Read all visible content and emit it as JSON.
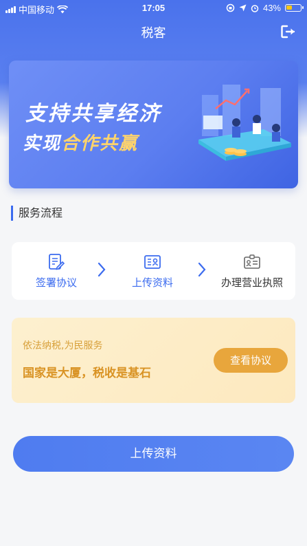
{
  "status_bar": {
    "carrier": "中国移动",
    "time": "17:05",
    "battery": "43%",
    "icons": [
      "signal-icon",
      "wifi-icon",
      "orientation-lock-icon",
      "location-icon",
      "alarm-icon",
      "battery-icon"
    ]
  },
  "nav": {
    "title": "税客",
    "logout_icon": "logout-icon"
  },
  "banner": {
    "line1": "支持共享经济",
    "line2_white": "实现",
    "line2_highlight": "合作共赢",
    "highlight_color": "#ffd46b"
  },
  "section": {
    "title": "服务流程"
  },
  "process": {
    "steps": [
      {
        "label": "签署协议",
        "icon": "sign-document-icon"
      },
      {
        "label": "上传资料",
        "icon": "id-card-icon"
      },
      {
        "label": "办理营业执照",
        "icon": "business-license-icon"
      }
    ]
  },
  "notice": {
    "subtitle": "依法纳税,为民服务",
    "headline": "国家是大厦，税收是基石",
    "button": "查看协议"
  },
  "action": {
    "upload_button": "上传资料"
  },
  "colors": {
    "primary": "#3b6bef",
    "accent_orange": "#e8a63c",
    "background": "#f5f6f8"
  }
}
